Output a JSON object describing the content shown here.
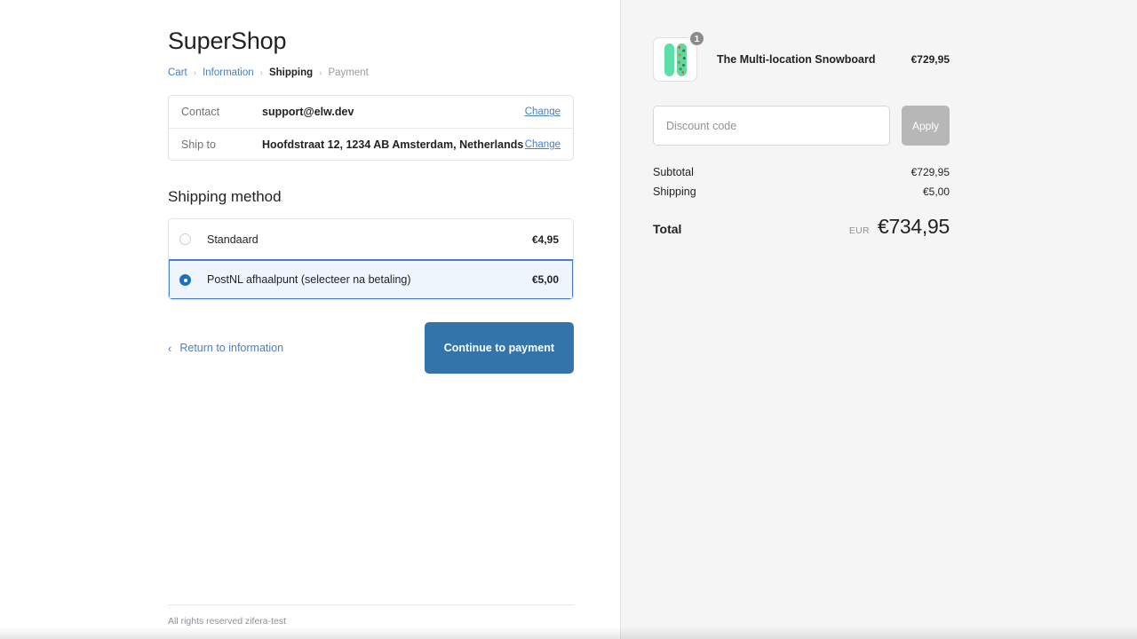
{
  "shop": {
    "name": "SuperShop"
  },
  "breadcrumb": {
    "items": [
      {
        "label": "Cart",
        "state": "link"
      },
      {
        "label": "Information",
        "state": "link"
      },
      {
        "label": "Shipping",
        "state": "current"
      },
      {
        "label": "Payment",
        "state": "future"
      }
    ],
    "separator": "›"
  },
  "review": {
    "rows": [
      {
        "label": "Contact",
        "value": "support@elw.dev",
        "action": "Change"
      },
      {
        "label": "Ship to",
        "value": "Hoofdstraat 12, 1234 AB Amsterdam, Netherlands",
        "action": "Change"
      }
    ]
  },
  "shipping": {
    "section_title": "Shipping method",
    "options": [
      {
        "name": "Standaard",
        "price": "€4,95",
        "selected": false
      },
      {
        "name": "PostNL afhaalpunt (selecteer na betaling)",
        "price": "€5,00",
        "selected": true
      }
    ]
  },
  "actions": {
    "return_label": "Return to information",
    "return_icon": "chevron-left-icon",
    "continue_label": "Continue to payment"
  },
  "footer": {
    "text": "All rights reserved zifera-test"
  },
  "summary": {
    "item": {
      "title": "The Multi-location Snowboard",
      "price": "€729,95",
      "quantity": "1",
      "thumbnail_icon": "snowboard-pair-icon"
    },
    "discount": {
      "placeholder": "Discount code",
      "value": "",
      "apply_label": "Apply"
    },
    "lines": [
      {
        "label": "Subtotal",
        "amount": "€729,95"
      },
      {
        "label": "Shipping",
        "amount": "€5,00"
      }
    ],
    "total": {
      "label": "Total",
      "currency": "EUR",
      "amount": "€734,95"
    }
  },
  "colors": {
    "accent_blue": "#3374ab",
    "link_blue": "#4a7fc1",
    "radio_selected": "#1f6fc0",
    "selected_row_bg": "#eff5fd",
    "summary_bg": "#f5f5f5",
    "apply_disabled": "#b7b7b7",
    "badge_gray": "#8c8c8c",
    "board_green": "#5fdfa8"
  }
}
